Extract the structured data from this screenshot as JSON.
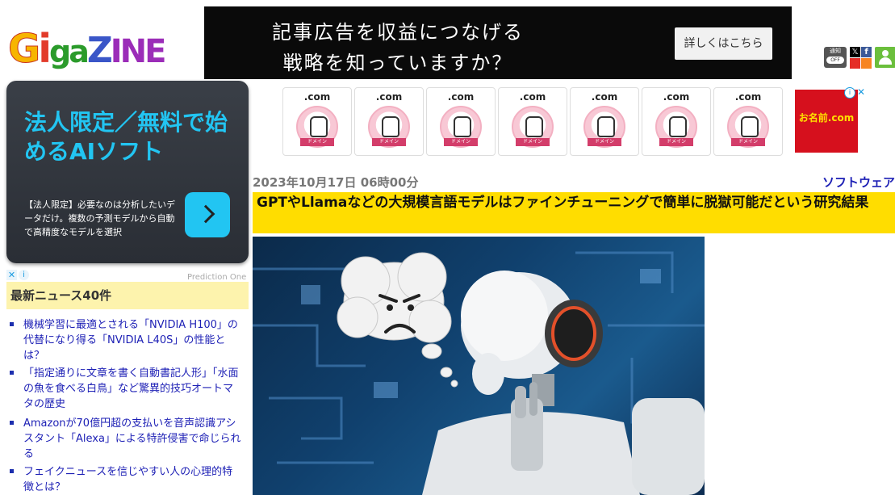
{
  "header": {
    "logo": {
      "g": "G",
      "i": "i",
      "ga": "ga",
      "z": "Z",
      "ine": "INE"
    },
    "ad": {
      "line1": "記事広告を収益につなげる",
      "line2": "戦略を知っていますか？",
      "button": "詳しくはこちら"
    },
    "icons": {
      "notify_label": "通知",
      "notify_state": "OFF",
      "x": "𝕏",
      "facebook": "f"
    }
  },
  "sidebar": {
    "ad": {
      "headline": "法人限定／無料で始めるAIソフト",
      "description": "【法人限定】必要なのは分析したいデータだけ。複数の予測モデルから自動で高精度なモデルを選択",
      "source": "Prediction One"
    },
    "ad_controls": {
      "close": "✕",
      "info": "i"
    },
    "news": {
      "title": "最新ニュース40件",
      "items": [
        {
          "text": "機械学習に最適とされる「NVIDIA H100」の代替になり得る「NVIDIA L40S」の性能とは？"
        },
        {
          "text": "「指定通りに文章を書く自動書記人形」「水面の魚を食べる白鳥」など驚異的技巧オートマタの歴史"
        },
        {
          "text": "Amazonが70億円超の支払いを音声認識アシスタント「Alexa」による特許侵害で命じられる"
        },
        {
          "text": "フェイクニュースを信じやすい人の心理的特徴とは？"
        }
      ]
    }
  },
  "domain_ads": {
    "cards": [
      {
        "label": ".com",
        "tag": "ドメイン"
      },
      {
        "label": ".com",
        "tag": "ドメイン"
      },
      {
        "label": ".com",
        "tag": "ドメイン"
      },
      {
        "label": ".com",
        "tag": "ドメイン"
      },
      {
        "label": ".com",
        "tag": "ドメイン"
      },
      {
        "label": ".com",
        "tag": "ドメイン"
      },
      {
        "label": ".com",
        "tag": "ドメイン"
      }
    ],
    "side": {
      "brand": "お名前.com",
      "info": "i",
      "close": "✕"
    }
  },
  "article": {
    "date": "2023年10月17日 06時00分",
    "category": "ソフトウェア",
    "title": "GPTやLlamaなどの大規模言語モデルはファインチューニングで簡単に脱獄可能だという研究結果"
  }
}
